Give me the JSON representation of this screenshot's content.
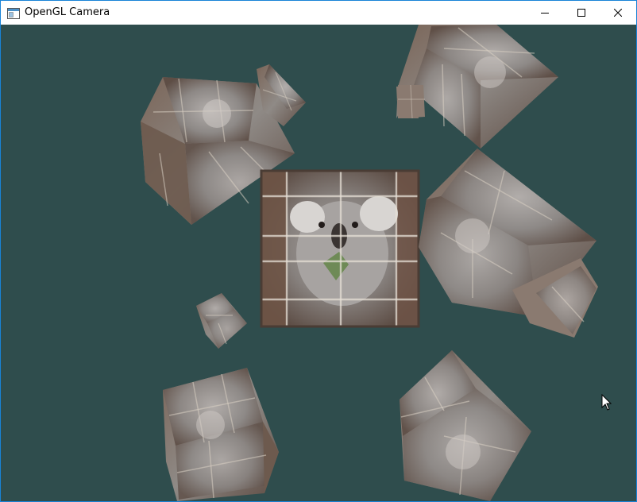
{
  "window": {
    "title": "OpenGL Camera",
    "border_color": "#1883d7"
  },
  "titlebar": {
    "icons": {
      "app": "app-window-icon",
      "minimize": "minimize-icon",
      "maximize": "maximize-icon",
      "close": "close-icon"
    }
  },
  "scene": {
    "clear_color": "#2f4d4d",
    "texture": "koala-crate",
    "cube_count": 9
  },
  "cursor": {
    "icon": "mouse-pointer-icon"
  }
}
